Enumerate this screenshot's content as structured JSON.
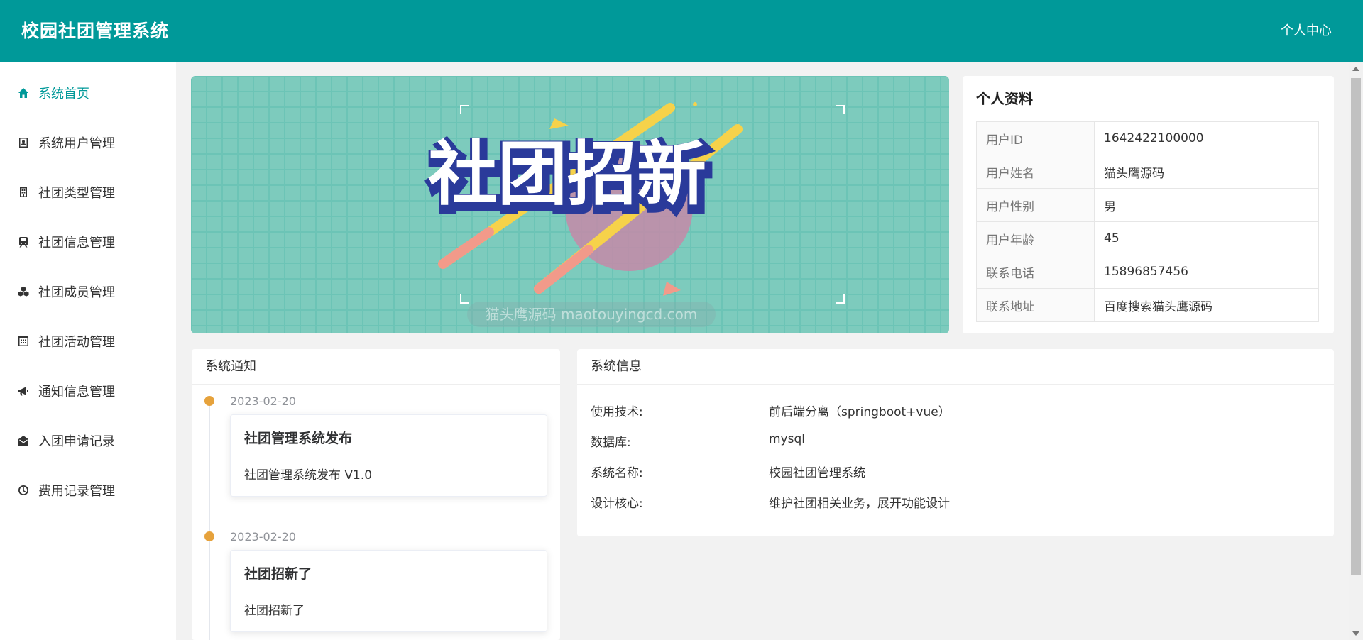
{
  "header": {
    "title": "校园社团管理系统",
    "user_center": "个人中心"
  },
  "colors": {
    "primary": "#009999",
    "timeline_dot": "#e6a23c",
    "banner_bg": "#6cc4b6"
  },
  "sidebar": {
    "items": [
      {
        "label": "系统首页",
        "icon": "home-icon",
        "active": true
      },
      {
        "label": "系统用户管理",
        "icon": "user-card-icon"
      },
      {
        "label": "社团类型管理",
        "icon": "building-icon"
      },
      {
        "label": "社团信息管理",
        "icon": "train-icon"
      },
      {
        "label": "社团成员管理",
        "icon": "cubes-icon"
      },
      {
        "label": "社团活动管理",
        "icon": "calendar-icon"
      },
      {
        "label": "通知信息管理",
        "icon": "bullhorn-icon"
      },
      {
        "label": "入团申请记录",
        "icon": "envelope-open-icon"
      },
      {
        "label": "费用记录管理",
        "icon": "clock-icon"
      }
    ]
  },
  "banner": {
    "text": "社团招新",
    "watermark": "猫头鹰源码 maotouyingcd.com"
  },
  "profile": {
    "title": "个人资料",
    "rows": [
      {
        "key": "用户ID",
        "value": "1642422100000"
      },
      {
        "key": "用户姓名",
        "value": "猫头鹰源码"
      },
      {
        "key": "用户性别",
        "value": "男"
      },
      {
        "key": "用户年龄",
        "value": "45"
      },
      {
        "key": "联系电话",
        "value": "15896857456"
      },
      {
        "key": "联系地址",
        "value": "百度搜索猫头鹰源码"
      }
    ]
  },
  "notice": {
    "title": "系统通知",
    "items": [
      {
        "date": "2023-02-20",
        "title": "社团管理系统发布",
        "content": "社团管理系统发布 V1.0"
      },
      {
        "date": "2023-02-20",
        "title": "社团招新了",
        "content": "社团招新了"
      }
    ]
  },
  "sysinfo": {
    "title": "系统信息",
    "rows": [
      {
        "key": "使用技术:",
        "value": "前后端分离（springboot+vue）"
      },
      {
        "key": "数据库:",
        "value": "mysql"
      },
      {
        "key": "系统名称:",
        "value": "校园社团管理系统"
      },
      {
        "key": "设计核心:",
        "value": "维护社团相关业务，展开功能设计"
      }
    ]
  }
}
